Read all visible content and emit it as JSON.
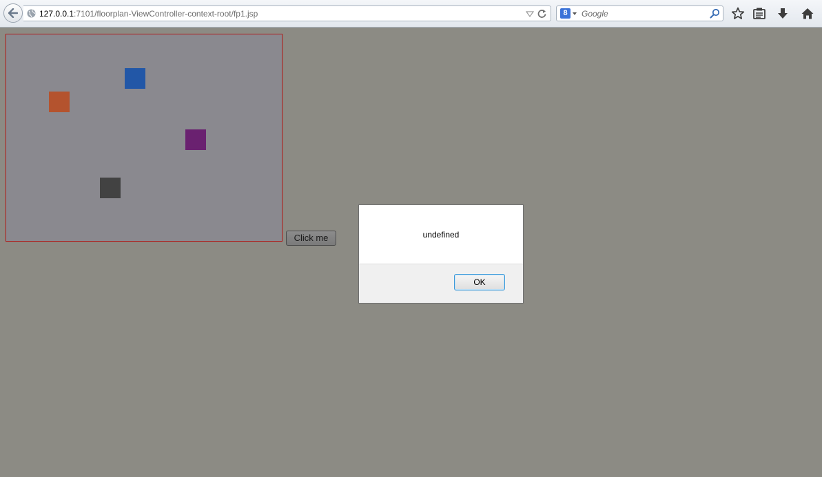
{
  "browser": {
    "url_host": "127.0.0.1",
    "url_path": ":7101/floorplan-ViewController-context-root/fp1.jsp",
    "search_placeholder": "Google",
    "search_engine_letter": "8"
  },
  "page": {
    "button_label": "Click me",
    "canvas_border_color": "#b01616",
    "squares": [
      {
        "name": "blue",
        "color": "#2257a7"
      },
      {
        "name": "orange",
        "color": "#b4532e"
      },
      {
        "name": "purple",
        "color": "#6a2170"
      },
      {
        "name": "dark-gray",
        "color": "#424242"
      }
    ]
  },
  "dialog": {
    "message": "undefined",
    "ok_label": "OK"
  }
}
